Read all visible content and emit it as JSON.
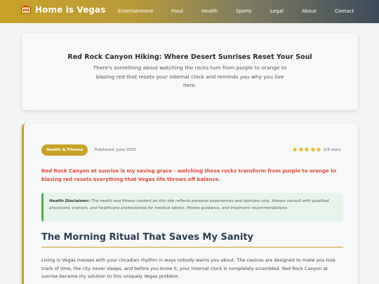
{
  "header": {
    "brand": "Home is Vegas",
    "nav": [
      "Entertainment",
      "Food",
      "Health",
      "Sports",
      "Legal",
      "About",
      "Contact"
    ]
  },
  "hero": {
    "title": "Red Rock Canyon Hiking: Where Desert Sunrises Reset Your Soul",
    "subtitle": "There's something about watching the rocks turn from purple to orange to blazing red that resets your internal clock and reminds you why you live here."
  },
  "article": {
    "tag": "Health & Fitness",
    "published": "Published: June 2025",
    "rating_value": 5,
    "rating_text": "5/5 stars",
    "lead": "Red Rock Canyon at sunrise is my saving grace - watching those rocks transform from purple to orange to blazing red resets everything that Vegas life throws off balance.",
    "disclaimer_label": "Health Disclaimer:",
    "disclaimer_text": "The health and fitness content on this site reflects personal experiences and opinions only. Always consult with qualified physicians, trainers, and healthcare professionals for medical advice, fitness guidance, and treatment recommendations.",
    "section_title": "The Morning Ritual That Saves My Sanity",
    "body": "Living in Vegas messes with your circadian rhythm in ways nobody warns you about. The casinos are designed to make you lose track of time, the city never sleeps, and before you know it, your internal clock is completely scrambled. Red Rock Canyon at sunrise became my solution to this uniquely Vegas problem."
  },
  "colors": {
    "accent": "#c9a227",
    "lead_red": "#e04a3c",
    "disclaimer_green": "#4caf50",
    "heading": "#2c3e50"
  }
}
